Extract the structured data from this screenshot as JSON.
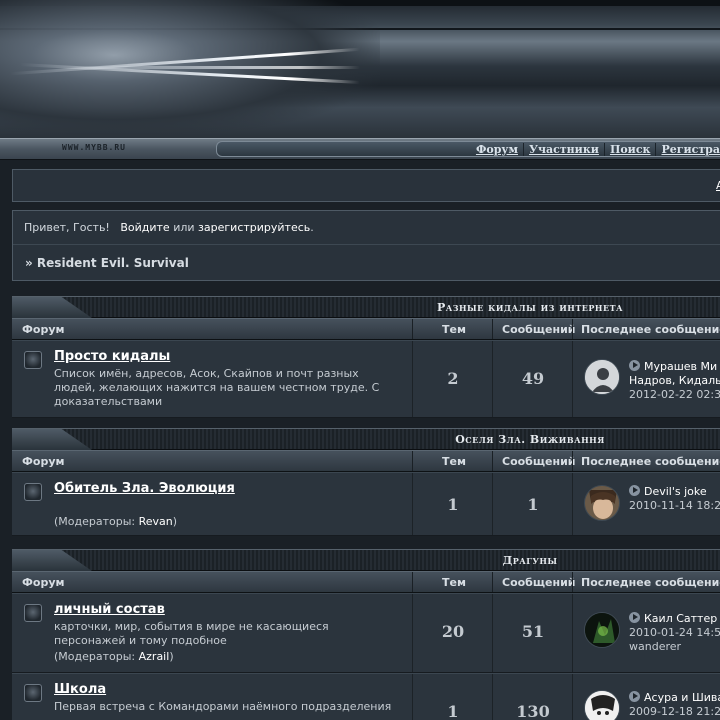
{
  "header": {
    "site_logo": "WWW.MYBB.RU"
  },
  "nav": {
    "items": [
      {
        "label": "Форум"
      },
      {
        "label": "Участники"
      },
      {
        "label": "Поиск"
      },
      {
        "label": "Регистра"
      }
    ]
  },
  "top_panel": {
    "edge_text": "А"
  },
  "welcome": {
    "greeting": "Привет, Гость!",
    "login_link": "Войдите",
    "or_text": "или",
    "register_link": "зарегистрируйтесь",
    "period": "."
  },
  "breadcrumb": {
    "text": "» Resident Evil. Survival"
  },
  "columns": {
    "forum": "Форум",
    "topics": "Тем",
    "posts": "Сообщений",
    "last_post": "Последнее сообщение"
  },
  "categories": [
    {
      "title": "Разные кидалы из интернета",
      "forums": [
        {
          "name": "Просто кидалы",
          "description": "Список имён, адресов, Асок, Скайпов и почт разных людей, желающих нажится на вашем честном труде. С доказательствами",
          "topics": "2",
          "posts": "49",
          "last_post": {
            "title": "Мурашев Ми",
            "title_cont": "Надров, Кидалы",
            "date": "2012-02-22 02:3",
            "avatar": "default-user-icon"
          }
        }
      ]
    },
    {
      "title": "Оселя Зла. Виживання",
      "forums": [
        {
          "name": "Обитель Зла. Эволюция",
          "mods_label": "(Модераторы:",
          "mods_name": "Revan",
          "mods_close": ")",
          "topics": "1",
          "posts": "1",
          "last_post": {
            "title": "Devil's joke",
            "date": "2010-11-14 18:2",
            "avatar": "anime-avatar-brown"
          }
        }
      ]
    },
    {
      "title": "Драгуны",
      "forums": [
        {
          "name": "личный состав",
          "description": "карточки, мир, события в мире не касающиеся персонажей и тому подобное",
          "mods_label": "(Модераторы:",
          "mods_name": "Azrail",
          "mods_close": ")",
          "topics": "20",
          "posts": "51",
          "last_post": {
            "title": "Каил Саттер",
            "date": "2010-01-24 14:5",
            "author": "wanderer",
            "avatar": "green-dark-avatar"
          }
        },
        {
          "name": "Школа",
          "description": "Первая встреча с Командорами наёмного подразделения",
          "topics": "1",
          "posts": "130",
          "last_post": {
            "title": "Асура и Шива",
            "date": "2009-12-18 21:2",
            "avatar": "sketch-avatar"
          }
        }
      ]
    }
  ]
}
